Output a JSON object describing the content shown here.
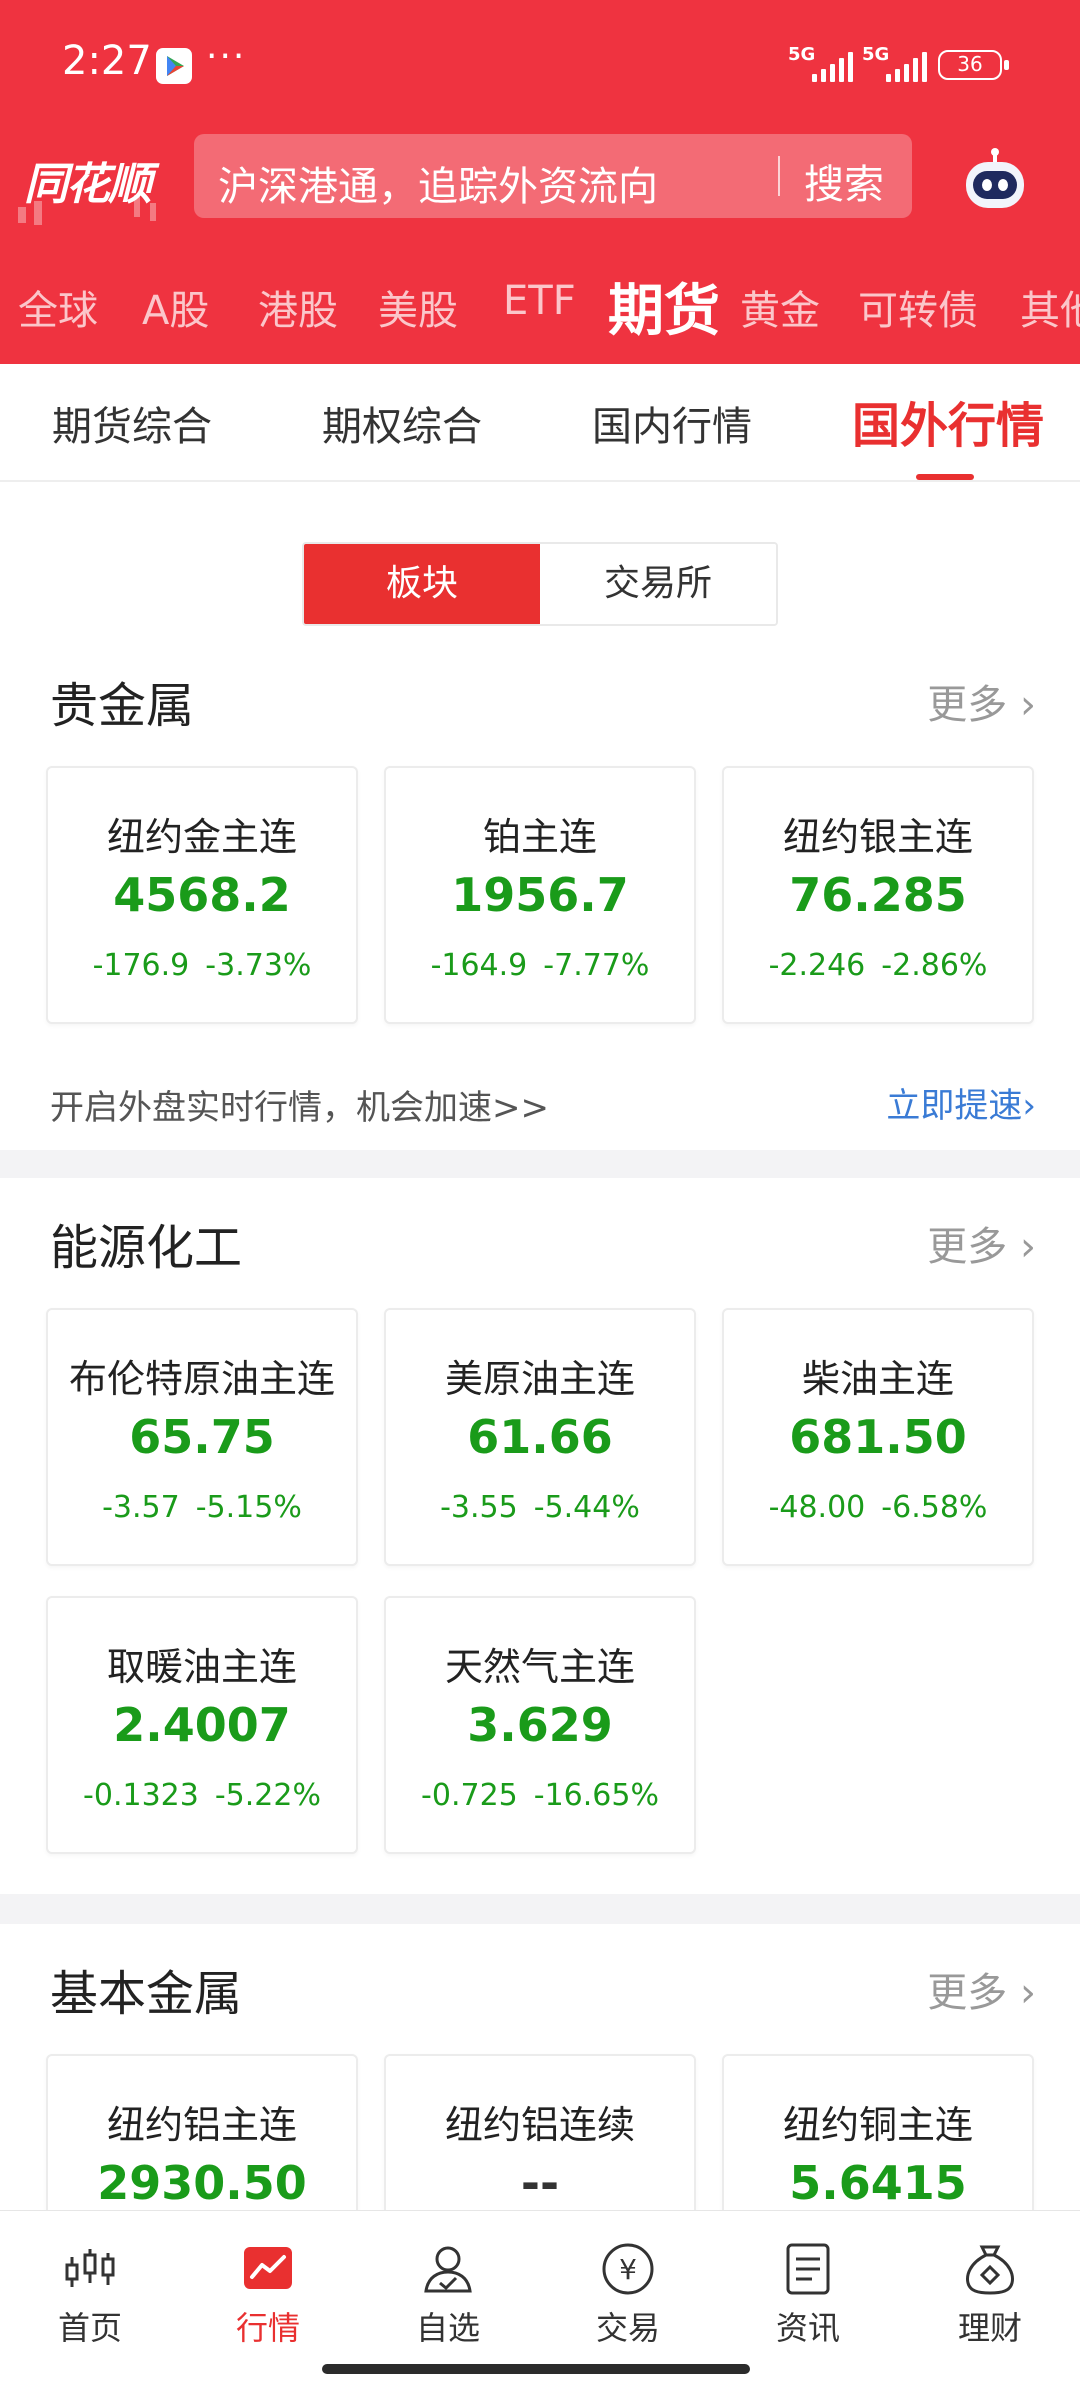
{
  "status_bar": {
    "time": "2:27",
    "dots": "···",
    "network1": "5G",
    "network2": "5G",
    "battery": "36"
  },
  "header": {
    "logo": "同花顺",
    "search_placeholder": "沪深港通，追踪外资流向",
    "search_button": "搜索"
  },
  "market_tabs": [
    "全球",
    "A股",
    "港股",
    "美股",
    "ETF",
    "期货",
    "黄金",
    "可转债",
    "其他"
  ],
  "active_market_tab": "期货",
  "sub_tabs": [
    "期货综合",
    "期权综合",
    "国内行情",
    "国外行情"
  ],
  "active_sub_tab": "国外行情",
  "segment": {
    "options": [
      "板块",
      "交易所"
    ],
    "active": "板块"
  },
  "sections": {
    "precious": {
      "title": "贵金属",
      "more": "更多",
      "cards": [
        {
          "name": "纽约金主连",
          "price": "4568.2",
          "change": "-176.9",
          "pct": "-3.73%"
        },
        {
          "name": "铂主连",
          "price": "1956.7",
          "change": "-164.9",
          "pct": "-7.77%"
        },
        {
          "name": "纽约银主连",
          "price": "76.285",
          "change": "-2.246",
          "pct": "-2.86%"
        }
      ],
      "promo_text": "开启外盘实时行情，机会加速>>",
      "promo_link": "立即提速"
    },
    "energy": {
      "title": "能源化工",
      "more": "更多",
      "cards": [
        {
          "name": "布伦特原油主连",
          "price": "65.75",
          "change": "-3.57",
          "pct": "-5.15%"
        },
        {
          "name": "美原油主连",
          "price": "61.66",
          "change": "-3.55",
          "pct": "-5.44%"
        },
        {
          "name": "柴油主连",
          "price": "681.50",
          "change": "-48.00",
          "pct": "-6.58%"
        },
        {
          "name": "取暖油主连",
          "price": "2.4007",
          "change": "-0.1323",
          "pct": "-5.22%"
        },
        {
          "name": "天然气主连",
          "price": "3.629",
          "change": "-0.725",
          "pct": "-16.65%"
        }
      ]
    },
    "base_metals": {
      "title": "基本金属",
      "more": "更多",
      "cards": [
        {
          "name": "纽约铝主连",
          "price": "2930.50"
        },
        {
          "name": "纽约铝连续",
          "price": "--"
        },
        {
          "name": "纽约铜主连",
          "price": "5.6415"
        }
      ]
    }
  },
  "bottom_nav": [
    "首页",
    "行情",
    "自选",
    "交易",
    "资讯",
    "理财"
  ],
  "active_nav": "行情",
  "colors": {
    "brand_red": "#ef3340",
    "down_green": "#1a9b1a",
    "link_blue": "#3a7bd5"
  }
}
